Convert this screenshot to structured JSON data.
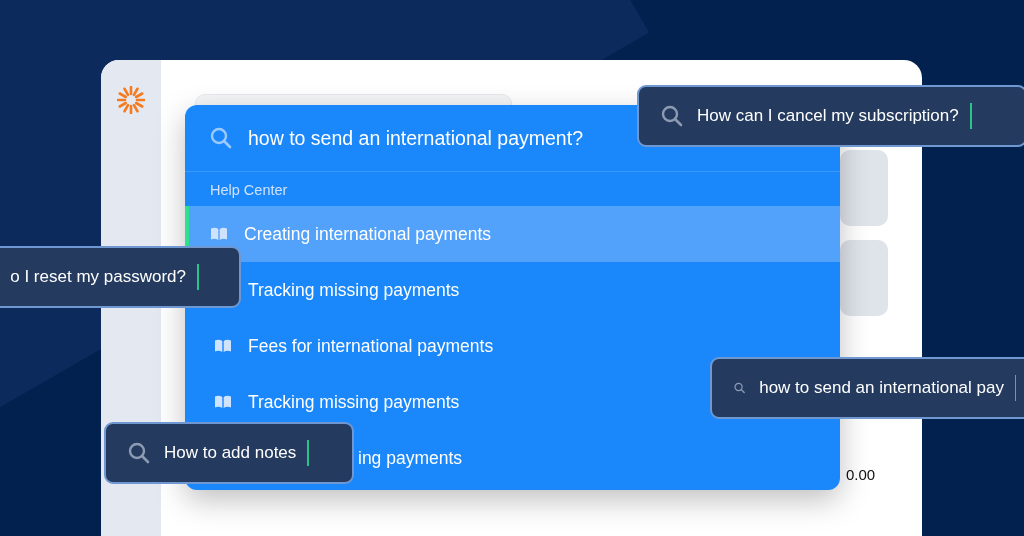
{
  "dropdown": {
    "query": "how to send an international payment?",
    "section": "Help Center",
    "results": [
      {
        "title": "Creating international payments",
        "selected": true
      },
      {
        "title": "Tracking missing payments",
        "selected": false
      },
      {
        "title": "Fees for international payments",
        "selected": false
      },
      {
        "title": "Tracking missing payments",
        "selected": false
      },
      {
        "title": "ing payments",
        "selected": false
      }
    ]
  },
  "table": {
    "amount": "0.00"
  },
  "floating_searches": [
    {
      "query": "How can I cancel my subscription?",
      "show_icon": true
    },
    {
      "query": "o I reset my password?",
      "show_icon": false
    },
    {
      "query": "how to send an international pay",
      "show_icon": true
    },
    {
      "query": "How to add notes",
      "show_icon": true
    }
  ]
}
